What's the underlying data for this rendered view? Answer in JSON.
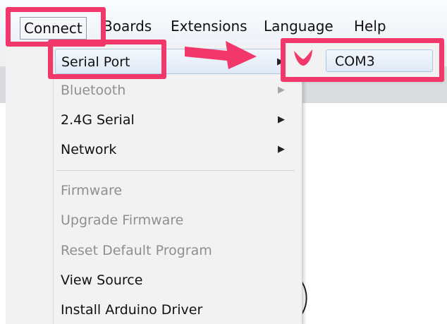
{
  "menubar": {
    "items": [
      "Connect",
      "Boards",
      "Extensions",
      "Language",
      "Help"
    ]
  },
  "connect_menu": {
    "items": [
      {
        "label": "Serial Port",
        "has_submenu": true,
        "enabled": true,
        "highlighted": true
      },
      {
        "label": "Bluetooth",
        "has_submenu": true,
        "enabled": false
      },
      {
        "label": "2.4G Serial",
        "has_submenu": true,
        "enabled": true
      },
      {
        "label": "Network",
        "has_submenu": true,
        "enabled": true
      },
      {
        "label": "Firmware",
        "has_submenu": false,
        "enabled": false
      },
      {
        "label": "Upgrade Firmware",
        "has_submenu": false,
        "enabled": false
      },
      {
        "label": "Reset Default Program",
        "has_submenu": false,
        "enabled": false
      },
      {
        "label": "View Source",
        "has_submenu": false,
        "enabled": true
      },
      {
        "label": "Install Arduino Driver",
        "has_submenu": false,
        "enabled": true
      }
    ]
  },
  "serial_submenu": {
    "items": [
      {
        "label": "COM3",
        "checked": true
      }
    ]
  },
  "annotations": {
    "highlight_color": "#f2376b"
  },
  "icons": {
    "submenu_arrow": "chevron-right-icon",
    "checkmark": "check-icon"
  }
}
